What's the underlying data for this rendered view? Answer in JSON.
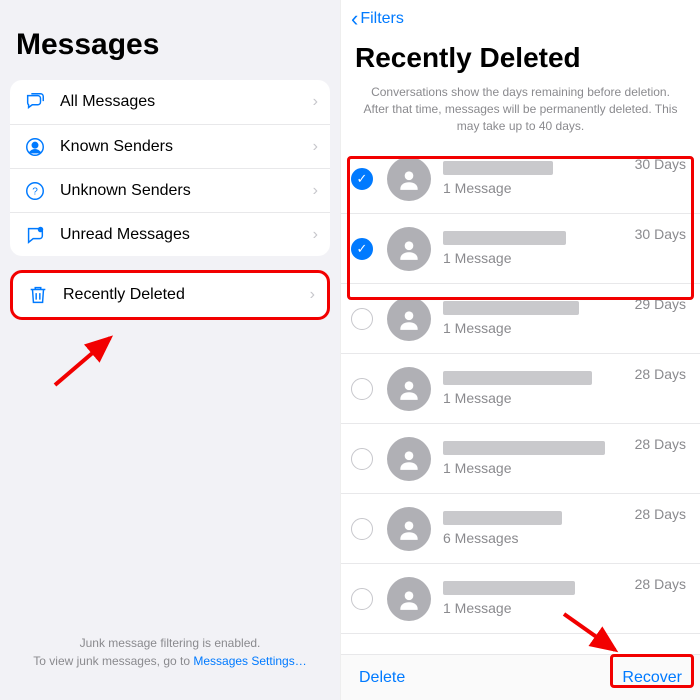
{
  "left": {
    "title": "Messages",
    "items": [
      {
        "label": "All Messages"
      },
      {
        "label": "Known Senders"
      },
      {
        "label": "Unknown Senders"
      },
      {
        "label": "Unread Messages"
      }
    ],
    "recently_deleted": {
      "label": "Recently Deleted"
    },
    "footer_line1": "Junk message filtering is enabled.",
    "footer_line2_a": "To view junk messages, go to ",
    "footer_line2_link": "Messages Settings…"
  },
  "right": {
    "back_label": "Filters",
    "title": "Recently Deleted",
    "note": "Conversations show the days remaining before deletion. After that time, messages will be permanently deleted. This may take up to 40 days.",
    "rows": [
      {
        "count": "1 Message",
        "days": "30 Days",
        "selected": true
      },
      {
        "count": "1 Message",
        "days": "30 Days",
        "selected": true
      },
      {
        "count": "1 Message",
        "days": "29 Days",
        "selected": false
      },
      {
        "count": "1 Message",
        "days": "28 Days",
        "selected": false
      },
      {
        "count": "1 Message",
        "days": "28 Days",
        "selected": false
      },
      {
        "count": "6 Messages",
        "days": "28 Days",
        "selected": false
      },
      {
        "count": "1 Message",
        "days": "28 Days",
        "selected": false
      }
    ],
    "delete_label": "Delete",
    "recover_label": "Recover"
  }
}
